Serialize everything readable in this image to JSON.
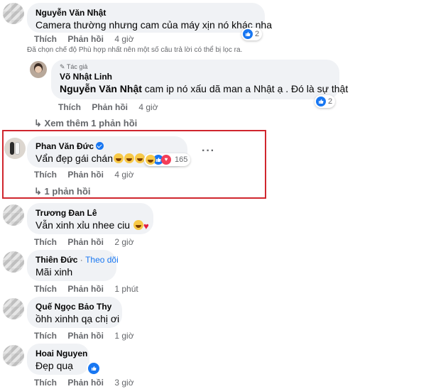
{
  "comments": {
    "c1": {
      "name": "Nguyễn Văn Nhật",
      "text": "Camera thường nhưng cam của máy xịn nó khác nha",
      "like": "Thích",
      "reply": "Phản hồi",
      "time": "4 giờ",
      "reactions": "2"
    },
    "notice": "Đã chọn chế độ Phù hợp nhất nên một số câu trả lời có thể bị lọc ra.",
    "r1": {
      "badge": "Tác giả",
      "name": "Võ Nhật Linh",
      "mention": "Nguyễn Văn Nhật",
      "text": " cam ip nó xấu dã man a Nhật ạ . Đó là sự thật",
      "like": "Thích",
      "reply": "Phản hồi",
      "time": "4 giờ",
      "reactions": "2"
    },
    "more_replies": "Xem thêm 1 phản hồi",
    "c2": {
      "name": "Phan Văn Đức",
      "text": "Vẩn đẹp gái chán",
      "like": "Thích",
      "reply": "Phản hồi",
      "time": "4 giờ",
      "reactions": "165",
      "replies": "1 phản hồi"
    },
    "c3": {
      "name": "Trương Đan Lê",
      "text": "Vẫn xinh xỉu nhee ciu",
      "like": "Thích",
      "reply": "Phản hồi",
      "time": "2 giờ"
    },
    "c4": {
      "name": "Thiên Đức",
      "follow": "Theo dõi",
      "text": "Mãi xinh",
      "like": "Thích",
      "reply": "Phản hồi",
      "time": "1 phút"
    },
    "c5": {
      "name": "Quế Ngọc Bảo Thy",
      "text": "ồhh xinhh qạ chị ơi",
      "like": "Thích",
      "reply": "Phản hồi",
      "time": "1 giờ"
    },
    "c6": {
      "name": "Hoai Nguyen",
      "text": "Đẹp quạ",
      "like": "Thích",
      "reply": "Phản hồi",
      "time": "3 giờ"
    }
  },
  "colors": {
    "accent": "#1877f2",
    "highlight": "#d0262e",
    "bubble": "#f0f2f5",
    "meta": "#65676b"
  }
}
